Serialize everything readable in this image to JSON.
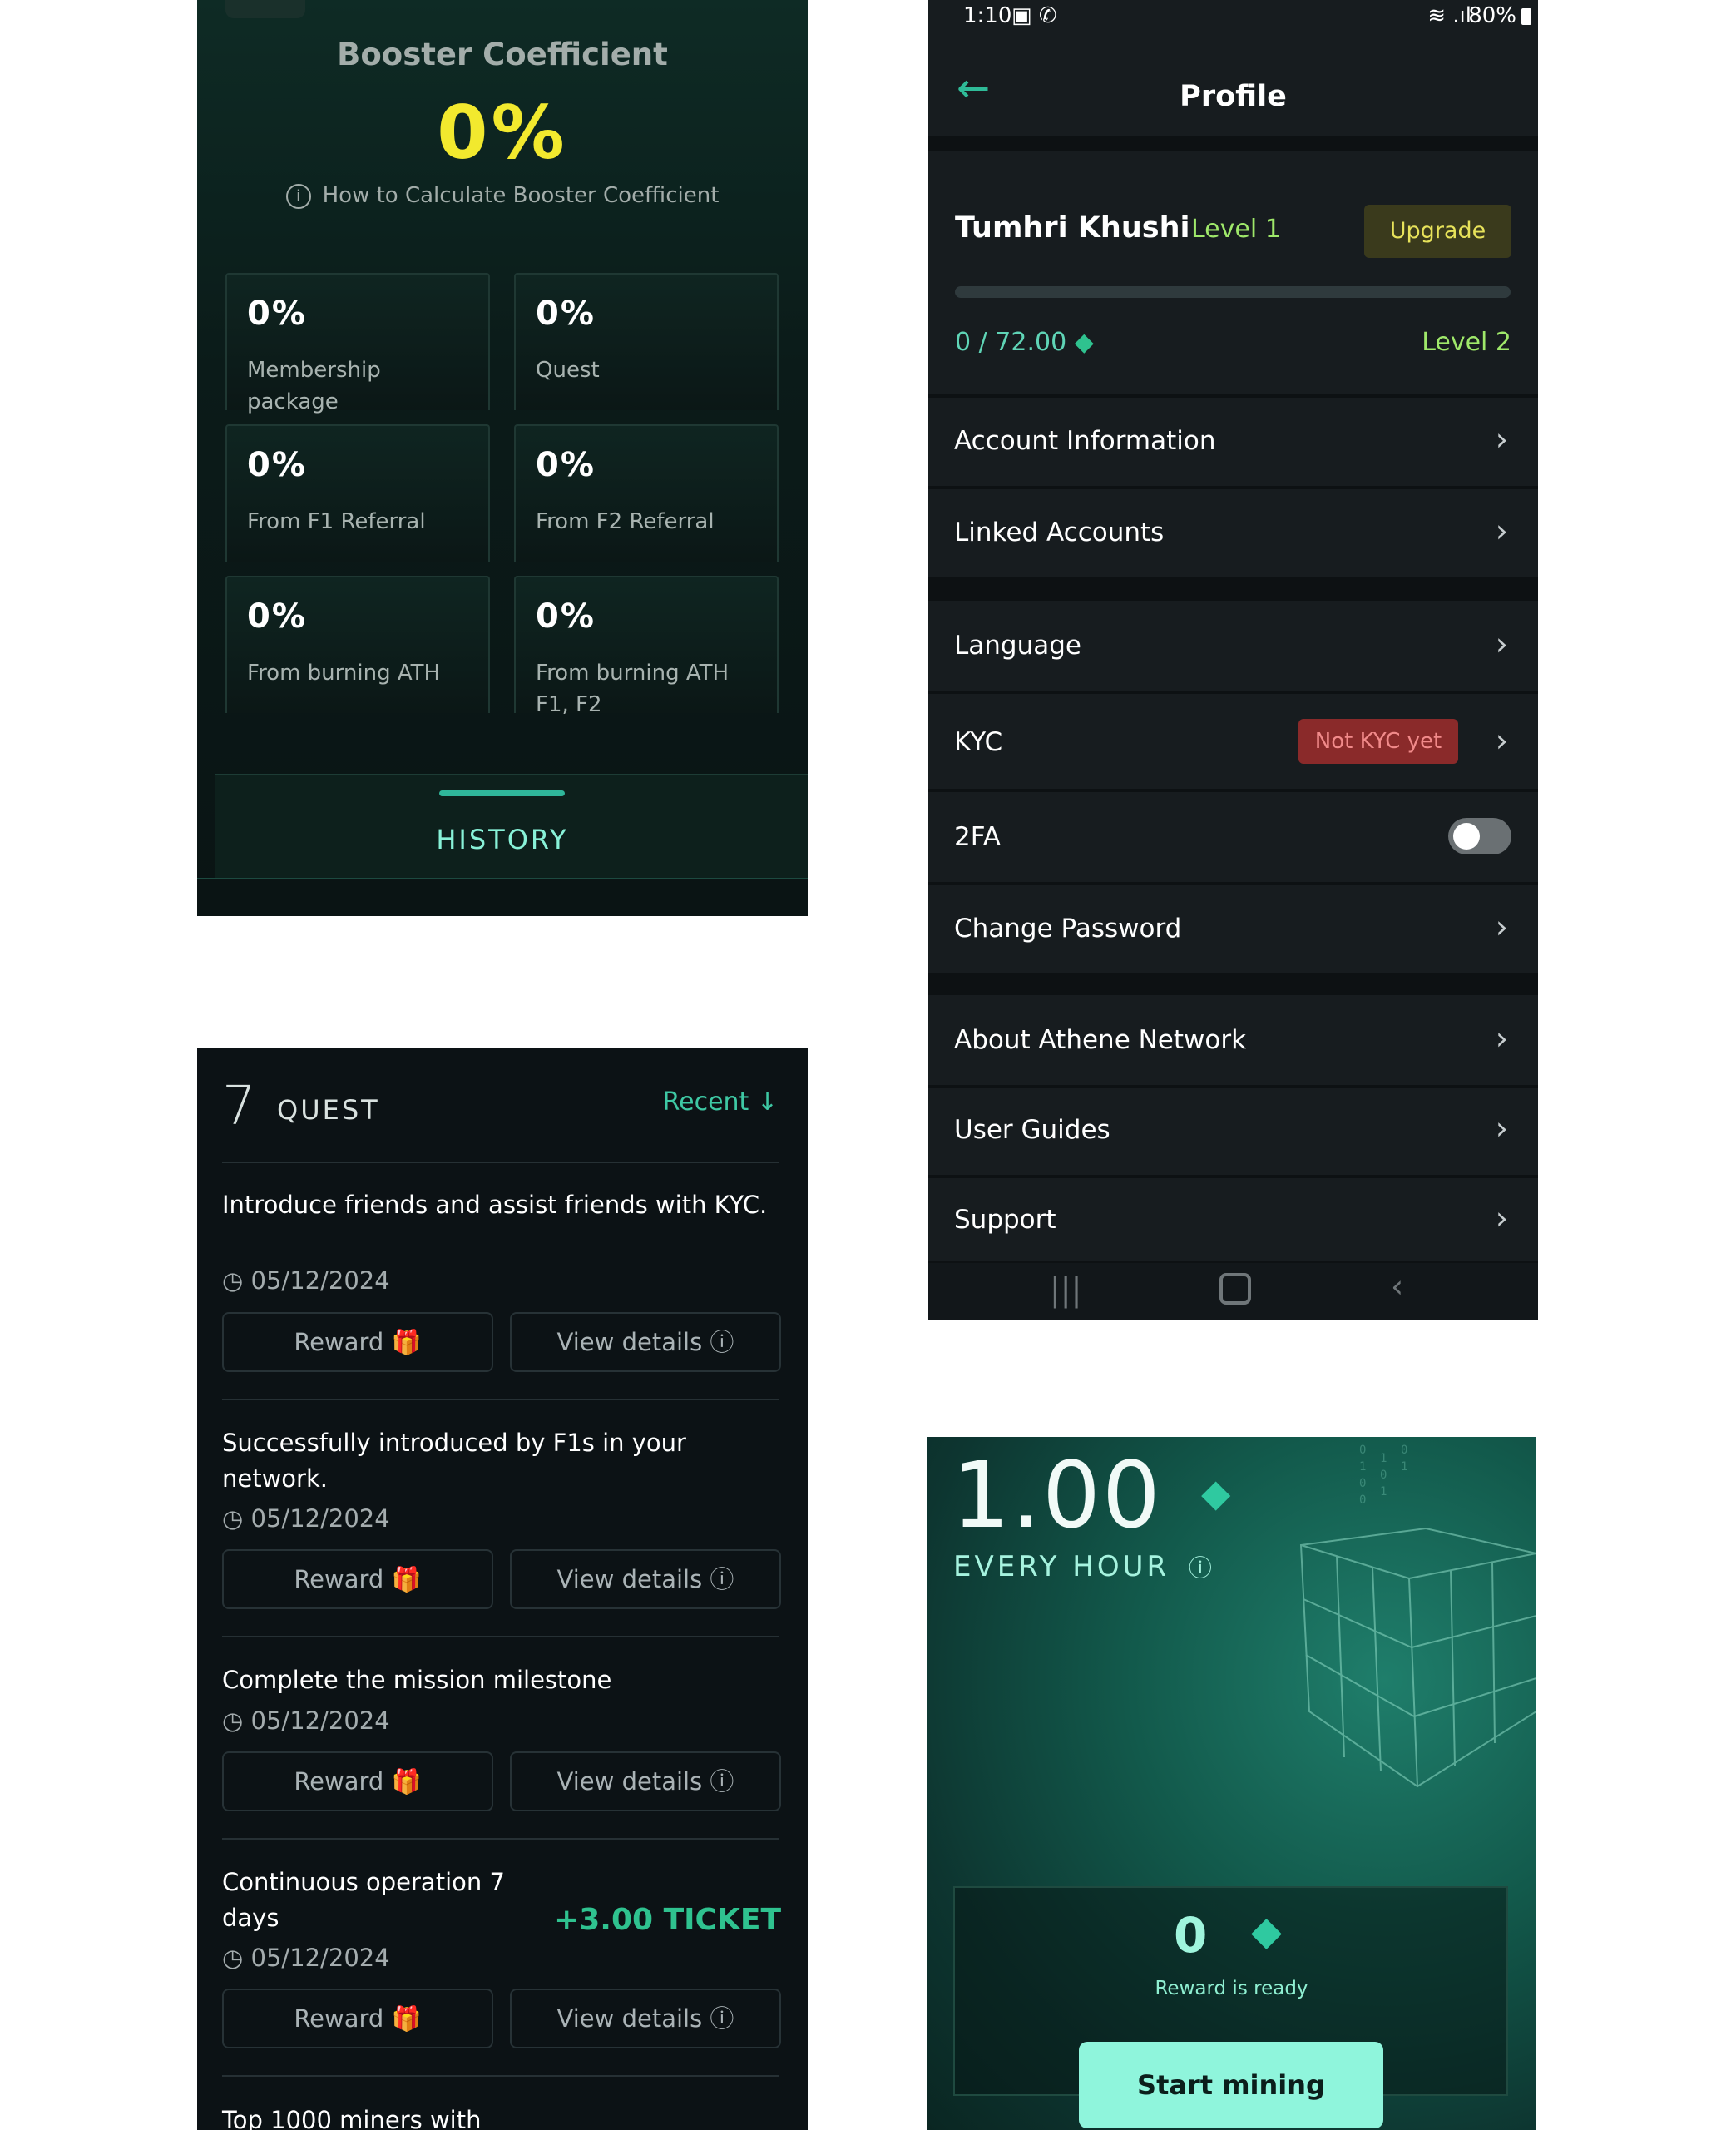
{
  "booster": {
    "title": "Booster Coefficient",
    "value": "0%",
    "howto": "How to Calculate Booster Coefficient",
    "cards": [
      {
        "value": "0%",
        "label": "Membership package"
      },
      {
        "value": "0%",
        "label": "Quest"
      },
      {
        "value": "0%",
        "label": "From F1 Referral"
      },
      {
        "value": "0%",
        "label": "From F2 Referral"
      },
      {
        "value": "0%",
        "label": "From burning ATH"
      },
      {
        "value": "0%",
        "label": "From burning ATH F1, F2"
      }
    ],
    "history": "HISTORY"
  },
  "quest": {
    "count": "7",
    "title": "QUEST",
    "sort": "Recent",
    "items": [
      {
        "title": "Introduce friends and assist friends with KYC.",
        "date": "05/12/2024",
        "reward": "Reward",
        "details": "View details"
      },
      {
        "title": "Successfully introduced by F1s in your network.",
        "date": "05/12/2024",
        "reward": "Reward",
        "details": "View details"
      },
      {
        "title": "Complete the mission milestone",
        "date": "05/12/2024",
        "reward": "Reward",
        "details": "View details"
      },
      {
        "title": "Continuous operation 7 days",
        "date": "05/12/2024",
        "reward": "Reward",
        "details": "View details",
        "bonus": "+3.00 TICKET"
      }
    ],
    "partial_title": "Top 1000 miners with"
  },
  "profile": {
    "status": {
      "time": "1:10",
      "battery": "80%"
    },
    "title": "Profile",
    "user": {
      "name": "Tumhri Khushi",
      "level": "Level 1",
      "upgrade": "Upgrade",
      "progress_text": "0 / 72.00",
      "progress_fraction": 0,
      "next_level": "Level 2"
    },
    "menu": {
      "account_information": "Account Information",
      "linked_accounts": "Linked Accounts",
      "language": "Language",
      "kyc": "KYC",
      "kyc_badge": "Not KYC yet",
      "twofa": "2FA",
      "twofa_enabled": false,
      "change_password": "Change Password",
      "about": "About Athene Network",
      "guides": "User Guides",
      "support": "Support"
    }
  },
  "mining": {
    "rate": "1.00",
    "unit": "EVERY HOUR",
    "reward_value": "0",
    "reward_status": "Reward is ready",
    "button": "Start mining"
  },
  "colors": {
    "accent": "#2fbb98",
    "booster_yellow": "#f2e92e",
    "upgrade_bg": "#3a3a1c",
    "kyc_badge_bg": "#8a2a2a",
    "start_button": "#8ff5dc"
  }
}
